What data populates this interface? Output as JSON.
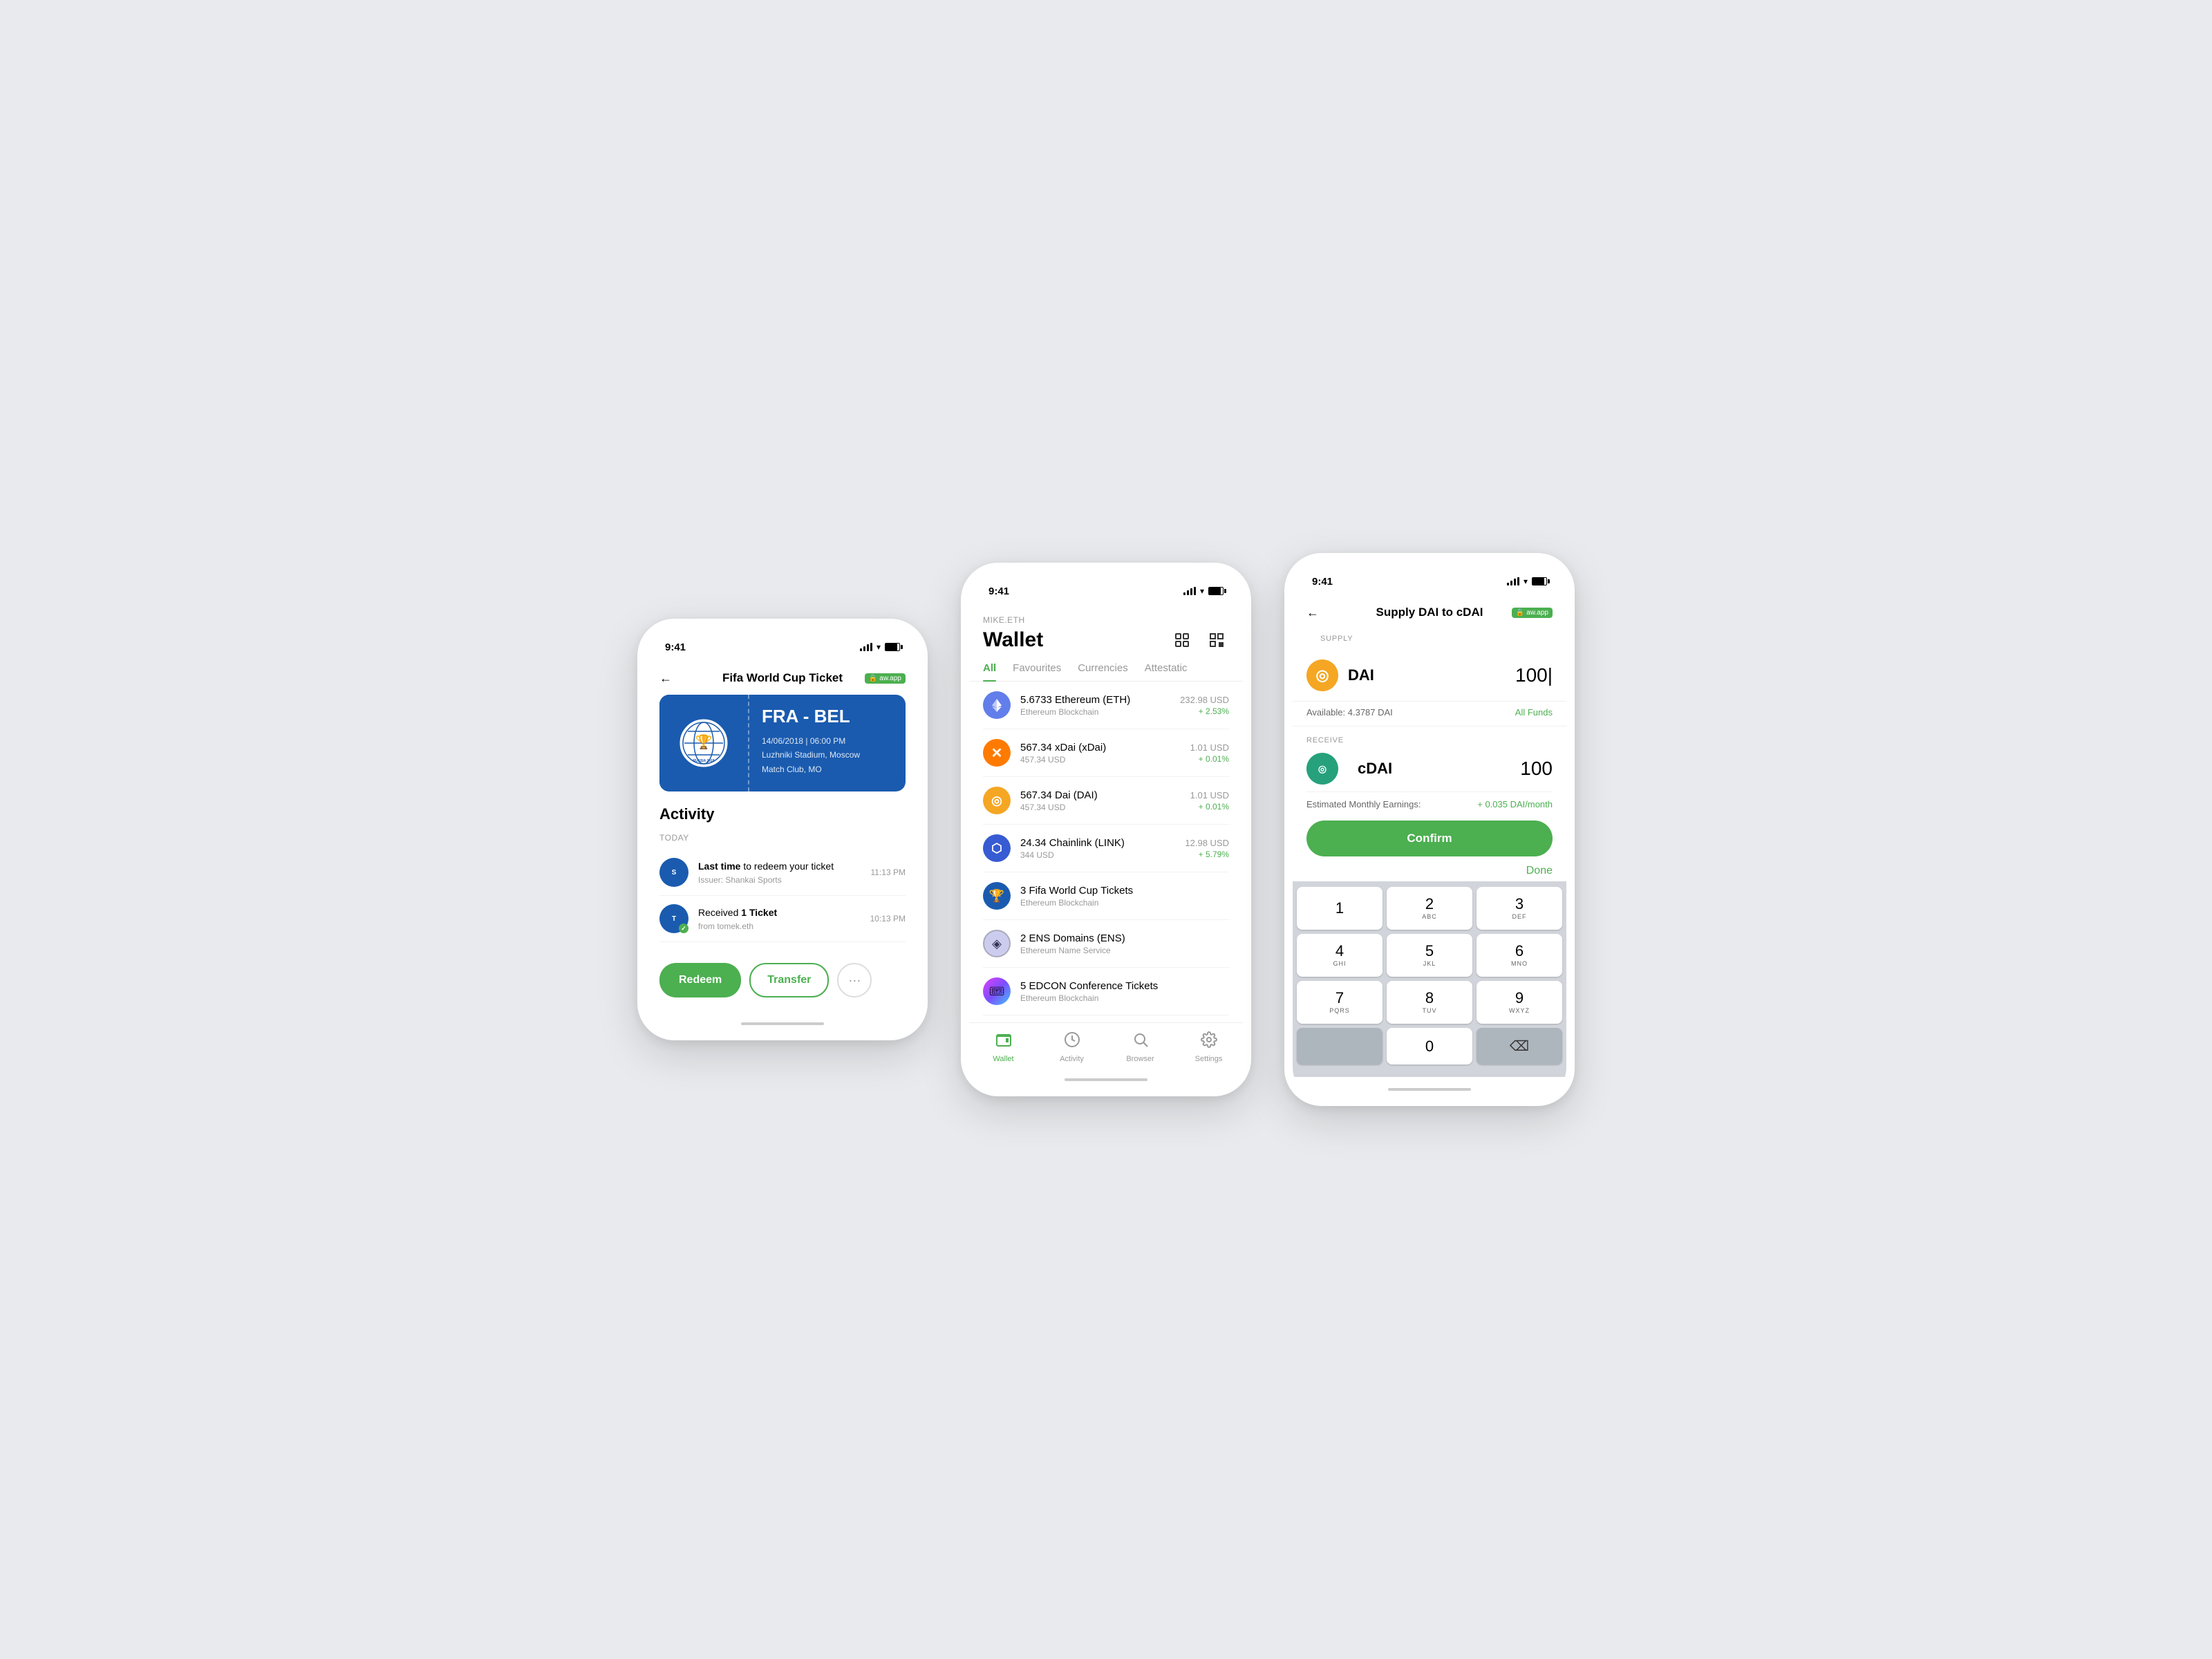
{
  "page": {
    "background": "#e8eaed"
  },
  "phone1": {
    "status_time": "9:41",
    "header": {
      "back_label": "←",
      "title": "Fifa World Cup Ticket",
      "badge": "aw.app"
    },
    "ticket": {
      "match": "FRA - BEL",
      "date": "14/06/2018 | 06:00 PM",
      "venue": "Luzhniki Stadium, Moscow",
      "club": "Match Club, MO"
    },
    "activity": {
      "title": "Activity",
      "today_label": "TODAY",
      "items": [
        {
          "text": "Last time to redeem your ticket",
          "highlight": "Last time",
          "sub": "Issuer: Shankai Sports",
          "time": "11:13 PM"
        },
        {
          "text": "Received 1 Ticket",
          "highlight": "1 Ticket",
          "sub": "from tomek.eth",
          "time": "10:13 PM"
        }
      ]
    },
    "actions": {
      "redeem": "Redeem",
      "transfer": "Transfer",
      "more": "···"
    }
  },
  "phone2": {
    "status_time": "9:41",
    "subtitle": "MIKE.ETH",
    "title": "Wallet",
    "tabs": [
      {
        "label": "All",
        "active": true
      },
      {
        "label": "Favourites",
        "active": false
      },
      {
        "label": "Currencies",
        "active": false
      },
      {
        "label": "Attestatic",
        "active": false
      }
    ],
    "tokens": [
      {
        "name": "5.6733 Ethereum (ETH)",
        "chain": "Ethereum Blockchain",
        "usd": "232.98 USD",
        "change": "+ 2.53%",
        "icon_type": "eth"
      },
      {
        "name": "567.34 xDai (xDai)",
        "chain": "457.34 USD",
        "usd": "1.01 USD",
        "change": "+ 0.01%",
        "icon_type": "xdai"
      },
      {
        "name": "567.34 Dai (DAI)",
        "chain": "457.34 USD",
        "usd": "1.01 USD",
        "change": "+ 0.01%",
        "icon_type": "dai"
      },
      {
        "name": "24.34 Chainlink (LINK)",
        "chain": "344 USD",
        "usd": "12.98 USD",
        "change": "+ 5.79%",
        "icon_type": "link"
      },
      {
        "name": "3 Fifa World Cup Tickets",
        "chain": "Ethereum Blockchain",
        "usd": "",
        "change": "",
        "icon_type": "ticket"
      },
      {
        "name": "2 ENS Domains (ENS)",
        "chain": "Ethereum Name Service",
        "usd": "",
        "change": "",
        "icon_type": "ens"
      },
      {
        "name": "5 EDCON Conference Tickets",
        "chain": "Ethereum Blockchain",
        "usd": "",
        "change": "",
        "icon_type": "edcon"
      }
    ],
    "nav": [
      {
        "label": "Wallet",
        "active": true,
        "icon": "wallet"
      },
      {
        "label": "Activity",
        "active": false,
        "icon": "activity"
      },
      {
        "label": "Browser",
        "active": false,
        "icon": "browser"
      },
      {
        "label": "Settings",
        "active": false,
        "icon": "settings"
      }
    ]
  },
  "phone3": {
    "status_time": "9:41",
    "header": {
      "back_label": "←",
      "title": "Supply DAI to cDAI",
      "badge": "aw.app"
    },
    "supply": {
      "section_label": "SUPPLY",
      "token_name": "DAI",
      "amount": "100|",
      "available": "Available: 4.3787 DAI",
      "all_funds": "All Funds"
    },
    "receive": {
      "section_label": "RECEIVE",
      "token_name": "cDAI",
      "amount": "100",
      "est_label": "Estimated Monthly Earnings:",
      "est_value": "+ 0.035 DAI/month"
    },
    "confirm_btn": "Confirm",
    "numpad": {
      "done_label": "Done",
      "keys": [
        [
          {
            "num": "1",
            "alpha": ""
          },
          {
            "num": "2",
            "alpha": "ABC"
          },
          {
            "num": "3",
            "alpha": "DEF"
          }
        ],
        [
          {
            "num": "4",
            "alpha": "GHI"
          },
          {
            "num": "5",
            "alpha": "JKL"
          },
          {
            "num": "6",
            "alpha": "MNO"
          }
        ],
        [
          {
            "num": "7",
            "alpha": "PQRS"
          },
          {
            "num": "8",
            "alpha": "TUV"
          },
          {
            "num": "9",
            "alpha": "WXYZ"
          }
        ],
        [
          {
            "num": "",
            "alpha": "",
            "type": "empty"
          },
          {
            "num": "0",
            "alpha": ""
          },
          {
            "num": "⌫",
            "alpha": "",
            "type": "delete"
          }
        ]
      ]
    }
  }
}
